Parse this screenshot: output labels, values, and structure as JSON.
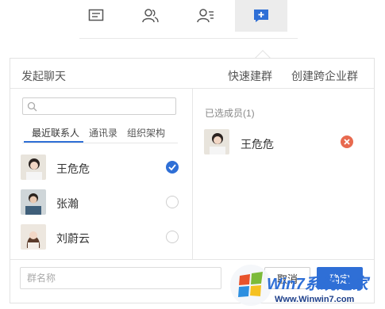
{
  "toolbar": {
    "tabs": [
      {
        "icon": "message-icon",
        "active": false
      },
      {
        "icon": "contacts-icon",
        "active": false
      },
      {
        "icon": "contact-list-icon",
        "active": false
      },
      {
        "icon": "add-chat-icon",
        "active": true
      }
    ]
  },
  "header": {
    "title": "发起聊天",
    "quick_group": "快速建群",
    "cross_org_group": "创建跨企业群"
  },
  "search": {
    "placeholder": ""
  },
  "subtabs": [
    "最近联系人",
    "通讯录",
    "组织架构"
  ],
  "contacts": [
    {
      "name": "王危危",
      "checked": true
    },
    {
      "name": "张瀚",
      "checked": false
    },
    {
      "name": "刘蔚云",
      "checked": false
    }
  ],
  "selected": {
    "title": "已选成员(1)",
    "members": [
      {
        "name": "王危危"
      }
    ]
  },
  "footer": {
    "group_name_placeholder": "群名称",
    "cancel_label": "取消",
    "ok_label": "确定"
  },
  "watermark": {
    "line1": "Win7系统之家",
    "line2": "Www.Winwin7.com"
  },
  "colors": {
    "accent": "#2f6fd6",
    "remove": "#e86a4f",
    "active_tab": "#ececec"
  }
}
